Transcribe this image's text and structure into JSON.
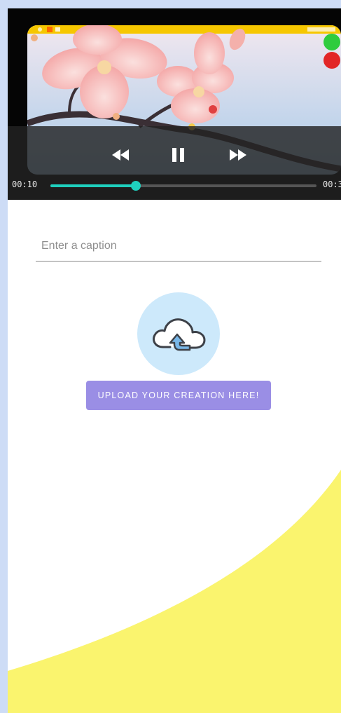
{
  "player": {
    "current_time": "00:10",
    "total_time": "00:3",
    "progress_fraction": 0.32,
    "accent_color": "#1fd0be"
  },
  "caption": {
    "placeholder": "Enter a caption",
    "value": ""
  },
  "upload": {
    "icon": "cloud-upload-icon",
    "button_label": "UPLOAD YOUR CREATION HERE!",
    "button_color": "#9a8ee5"
  },
  "theme": {
    "wave_color": "#faf46e",
    "upload_circle_color": "#cde9fb"
  }
}
